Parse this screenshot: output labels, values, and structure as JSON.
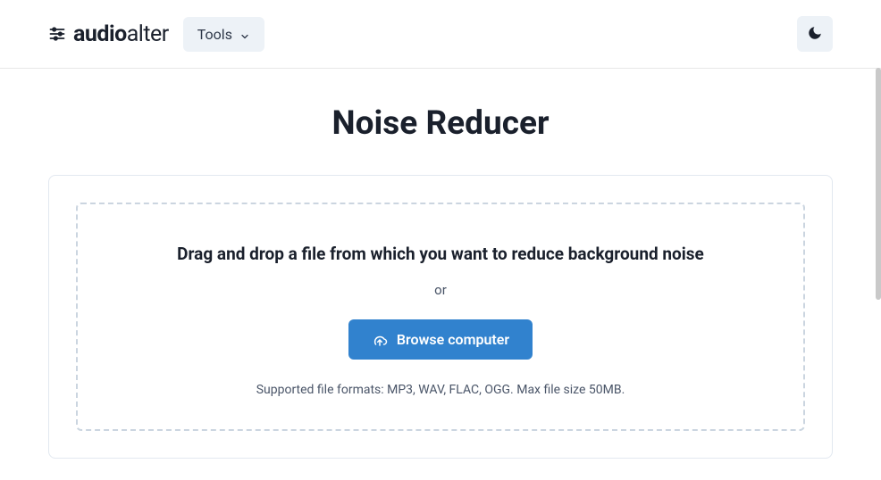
{
  "header": {
    "brand_prefix": "audio",
    "brand_suffix": "alter",
    "tools_label": "Tools"
  },
  "page": {
    "title": "Noise Reducer"
  },
  "dropzone": {
    "heading": "Drag and drop a file from which you want to reduce background noise",
    "or": "or",
    "browse_label": "Browse computer",
    "supported": "Supported file formats: MP3, WAV, FLAC, OGG. Max file size 50MB."
  }
}
